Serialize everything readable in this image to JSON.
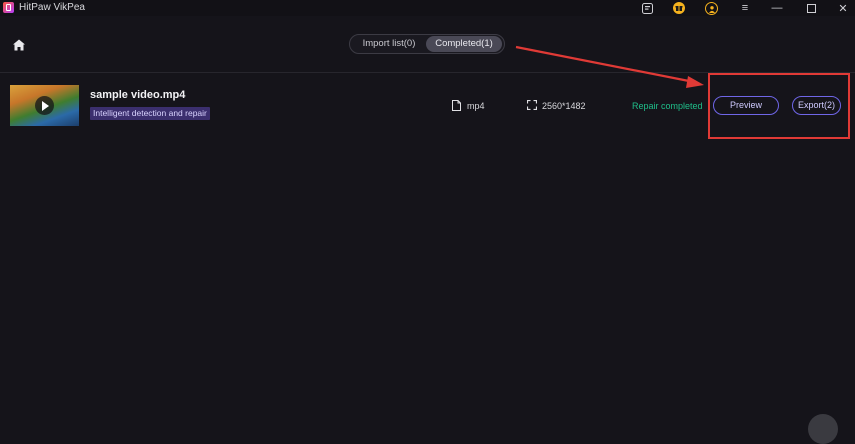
{
  "app": {
    "title": "HitPaw VikPea",
    "accent": "#6f66e8",
    "status_color": "#1fbf8a",
    "annotation_color": "#e03a36"
  },
  "titlebar": {
    "icons": [
      "feedback-icon",
      "gift-icon",
      "user-icon",
      "menu-icon",
      "minimize-icon",
      "maximize-icon",
      "close-icon"
    ],
    "glyphs": {
      "menu": "≡",
      "minimize": "—",
      "close": "✕"
    }
  },
  "tabs": {
    "import_label": "Import list(0)",
    "completed_label": "Completed(1)",
    "active": "completed"
  },
  "item": {
    "filename": "sample video.mp4",
    "tag": "Intelligent detection and repair",
    "format": "mp4",
    "resolution": "2560*1482",
    "status": "Repair completed",
    "preview_label": "Preview",
    "export_label": "Export(2)"
  }
}
